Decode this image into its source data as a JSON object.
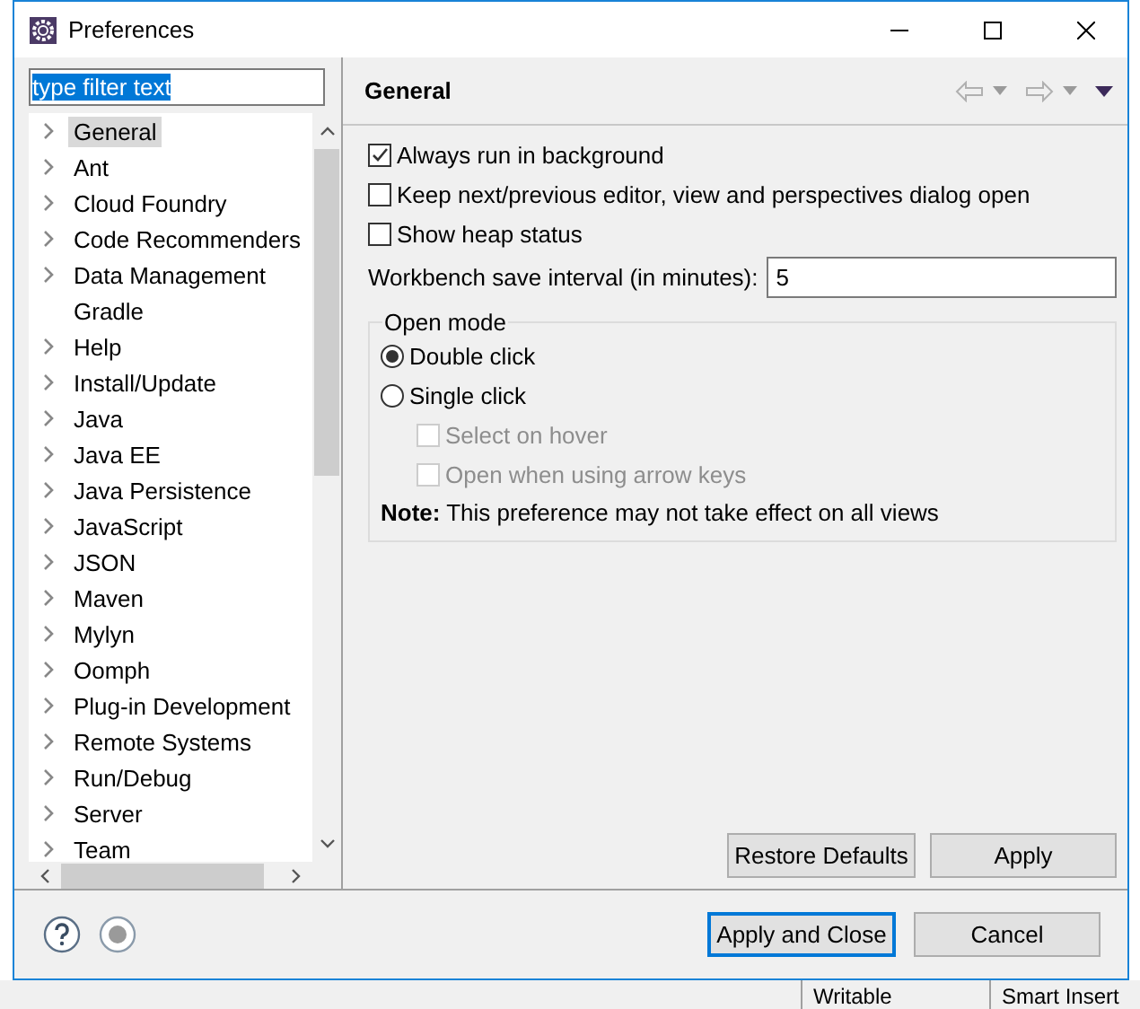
{
  "window": {
    "title": "Preferences"
  },
  "filter": {
    "value": "type filter text",
    "highlighted": true
  },
  "tree": [
    {
      "label": "General",
      "expandable": true,
      "selected": true
    },
    {
      "label": "Ant",
      "expandable": true,
      "selected": false
    },
    {
      "label": "Cloud Foundry",
      "expandable": true,
      "selected": false
    },
    {
      "label": "Code Recommenders",
      "expandable": true,
      "selected": false
    },
    {
      "label": "Data Management",
      "expandable": true,
      "selected": false
    },
    {
      "label": "Gradle",
      "expandable": false,
      "selected": false
    },
    {
      "label": "Help",
      "expandable": true,
      "selected": false
    },
    {
      "label": "Install/Update",
      "expandable": true,
      "selected": false
    },
    {
      "label": "Java",
      "expandable": true,
      "selected": false
    },
    {
      "label": "Java EE",
      "expandable": true,
      "selected": false
    },
    {
      "label": "Java Persistence",
      "expandable": true,
      "selected": false
    },
    {
      "label": "JavaScript",
      "expandable": true,
      "selected": false
    },
    {
      "label": "JSON",
      "expandable": true,
      "selected": false
    },
    {
      "label": "Maven",
      "expandable": true,
      "selected": false
    },
    {
      "label": "Mylyn",
      "expandable": true,
      "selected": false
    },
    {
      "label": "Oomph",
      "expandable": true,
      "selected": false
    },
    {
      "label": "Plug-in Development",
      "expandable": true,
      "selected": false
    },
    {
      "label": "Remote Systems",
      "expandable": true,
      "selected": false
    },
    {
      "label": "Run/Debug",
      "expandable": true,
      "selected": false
    },
    {
      "label": "Server",
      "expandable": true,
      "selected": false
    },
    {
      "label": "Team",
      "expandable": true,
      "selected": false
    }
  ],
  "page": {
    "title": "General",
    "options": [
      {
        "label": "Always run in background",
        "checked": true
      },
      {
        "label": "Keep next/previous editor, view and perspectives dialog open",
        "checked": false
      },
      {
        "label": "Show heap status",
        "checked": false
      }
    ],
    "save_interval": {
      "label": "Workbench save interval (in minutes):",
      "value": "5"
    },
    "open_mode": {
      "title": "Open mode",
      "choices": [
        {
          "label": "Double click",
          "selected": true
        },
        {
          "label": "Single click",
          "selected": false
        }
      ],
      "sub_options": [
        {
          "label": "Select on hover",
          "checked": false,
          "disabled": true
        },
        {
          "label": "Open when using arrow keys",
          "checked": false,
          "disabled": true
        }
      ],
      "note": "**Note:** This preference may not take effect on all views"
    },
    "buttons": [
      "Restore Defaults",
      "Apply"
    ]
  },
  "dialog_buttons": [
    {
      "label": "Apply and Close",
      "default": true
    },
    {
      "label": "Cancel",
      "default": false
    }
  ],
  "background_status": [
    "Writable",
    "Smart Insert"
  ]
}
